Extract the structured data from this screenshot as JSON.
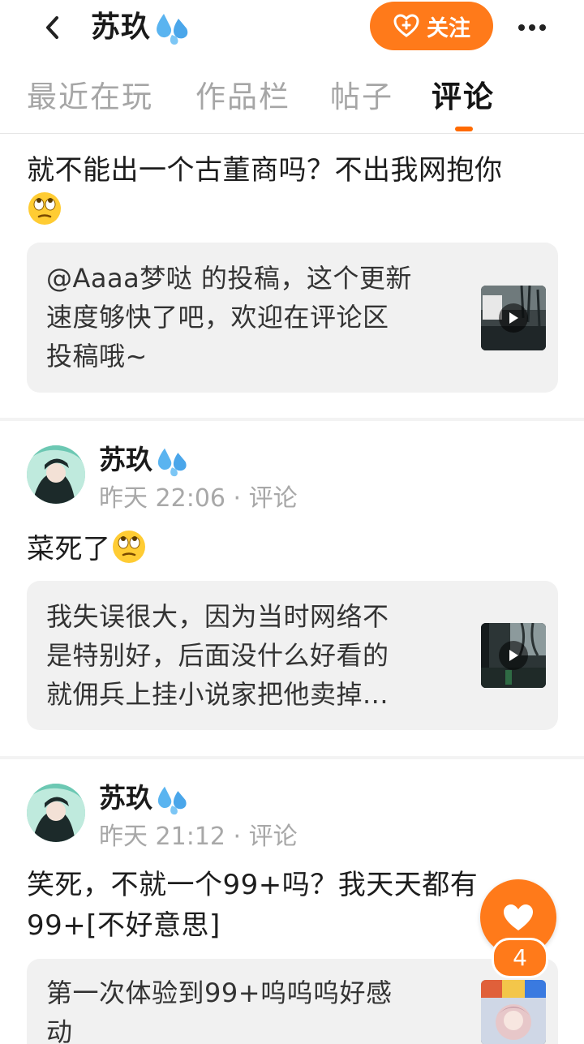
{
  "header": {
    "title": "苏玖",
    "follow_label": "关注",
    "back_icon": "chevron-left-icon",
    "more_icon": "more-horizontal-icon",
    "accent_color": "#ff7a1a"
  },
  "tabs": [
    {
      "label": "最近在玩",
      "active": false
    },
    {
      "label": "作品栏",
      "active": false
    },
    {
      "label": "帖子",
      "active": false
    },
    {
      "label": "评论",
      "active": true
    }
  ],
  "comments": [
    {
      "text_line1": "就不能出一个古董商吗？不出我网抱你",
      "quote_line1": "@Aaaa梦哒 的投稿，这个更新",
      "quote_line2": "速度够快了吧，欢迎在评论区",
      "quote_line3": "投稿哦~"
    },
    {
      "username": "苏玖",
      "meta": "昨天 22:06 · 评论",
      "text": "菜死了",
      "quote_line1": "我失误很大，因为当时网络不",
      "quote_line2": "是特别好，后面没什么好看的",
      "quote_line3": "就佣兵上挂小说家把他卖掉..."
    },
    {
      "username": "苏玖",
      "meta": "昨天 21:12 · 评论",
      "text_line1": "笑死，不就一个99+吗？我天天都有",
      "text_line2": "99+[不好意思]",
      "quote_line1": "第一次体验到99+呜呜呜好感",
      "quote_line2": "动"
    }
  ],
  "like": {
    "count": "4",
    "icon": "heart-icon"
  }
}
